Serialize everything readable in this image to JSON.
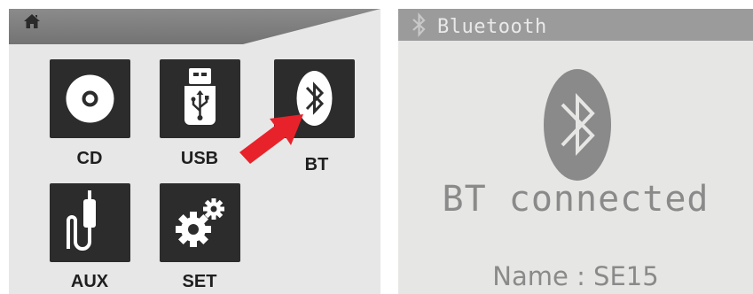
{
  "home_screen": {
    "items": [
      {
        "label": "CD",
        "icon": "disc-icon"
      },
      {
        "label": "USB",
        "icon": "usb-icon"
      },
      {
        "label": "BT",
        "icon": "bluetooth-icon"
      },
      {
        "label": "AUX",
        "icon": "aux-cable-icon"
      },
      {
        "label": "SET",
        "icon": "gears-icon"
      }
    ],
    "highlight_arrow_color": "#e8222a"
  },
  "bluetooth_screen": {
    "title": "Bluetooth",
    "status": "BT connected",
    "name_label": "Name : SE15"
  },
  "colors": {
    "tile_bg": "#2c2c2c",
    "panel_bg": "#e7e7e7",
    "bt_text": "#8a8a8a"
  }
}
